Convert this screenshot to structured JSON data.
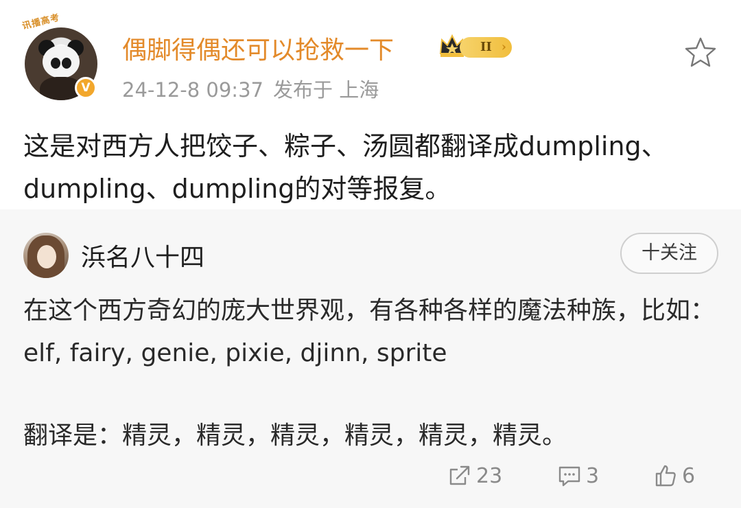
{
  "post": {
    "avatar_text": "讯播高考",
    "avatar_badge": "V",
    "username": "偶脚得偶还可以抢救一下",
    "level": "II",
    "datetime": "24-12-8 09:37",
    "location": "发布于 上海",
    "text": "这是对西方人把饺子、粽子、汤圆都翻译成dumpling、dumpling、dumpling的对等报复。"
  },
  "reply": {
    "username": "浜名八十四",
    "follow_label": "十关注",
    "line1": "在这个西方奇幻的庞大世界观，有各种各样的魔法种族，比如：elf, fairy, genie, pixie, djinn, sprite",
    "line2": "翻译是：精灵，精灵，精灵，精灵，精灵，精灵。",
    "repost_count": "23",
    "comment_count": "3",
    "like_count": "6"
  },
  "colors": {
    "username_accent": "#e38a2a",
    "meta_gray": "#9a9a9a",
    "badge_gold": "#f1be3d"
  },
  "icons": [
    "star-icon",
    "crown-icon",
    "repost-icon",
    "comment-icon",
    "like-icon"
  ]
}
